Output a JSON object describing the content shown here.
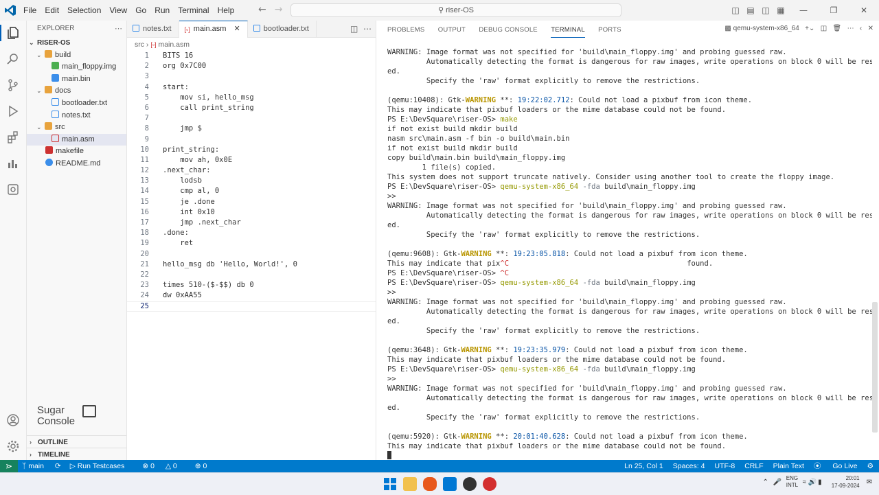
{
  "menu": [
    "File",
    "Edit",
    "Selection",
    "View",
    "Go",
    "Run",
    "Terminal",
    "Help"
  ],
  "search": {
    "text": "riser-OS"
  },
  "explorer": {
    "title": "EXPLORER",
    "root": "RISER-OS",
    "items": [
      {
        "label": "build",
        "type": "folder",
        "depth": 1
      },
      {
        "label": "main_floppy.img",
        "type": "img",
        "depth": 2
      },
      {
        "label": "main.bin",
        "type": "bin",
        "depth": 2
      },
      {
        "label": "docs",
        "type": "folder",
        "depth": 1
      },
      {
        "label": "bootloader.txt",
        "type": "txt",
        "depth": 2
      },
      {
        "label": "notes.txt",
        "type": "txt",
        "depth": 2
      },
      {
        "label": "src",
        "type": "folder",
        "depth": 1
      },
      {
        "label": "main.asm",
        "type": "asm",
        "depth": 2,
        "selected": true
      },
      {
        "label": "makefile",
        "type": "make",
        "depth": 1
      },
      {
        "label": "README.md",
        "type": "info",
        "depth": 1
      }
    ],
    "outline": "OUTLINE",
    "timeline": "TIMELINE"
  },
  "watermark": {
    "line1": "Sugar",
    "line2": "Console"
  },
  "tabs": [
    {
      "label": "notes.txt",
      "active": false
    },
    {
      "label": "main.asm",
      "active": true
    },
    {
      "label": "bootloader.txt",
      "active": false
    }
  ],
  "breadcrumb": {
    "folder": "src",
    "file": "main.asm"
  },
  "code": [
    "BITS 16",
    "org 0x7C00",
    "",
    "start:",
    "    mov si, hello_msg",
    "    call print_string",
    "",
    "    jmp $",
    "",
    "print_string:",
    "    mov ah, 0x0E",
    ".next_char:",
    "    lodsb",
    "    cmp al, 0",
    "    je .done",
    "    int 0x10",
    "    jmp .next_char",
    ".done:",
    "    ret",
    "",
    "hello_msg db 'Hello, World!', 0",
    "",
    "times 510-($-$$) db 0",
    "dw 0xAA55",
    ""
  ],
  "panel_tabs": [
    "PROBLEMS",
    "OUTPUT",
    "DEBUG CONSOLE",
    "TERMINAL",
    "PORTS"
  ],
  "active_panel_tab": "TERMINAL",
  "terminal_name": "qemu-system-x86_64",
  "terminal": [
    [
      {
        "t": "WARNING: Image format was not specified for 'build\\main_floppy.img' and probing guessed raw."
      }
    ],
    [
      {
        "t": "         Automatically detecting the format is dangerous for raw images, write operations on block 0 will be restrict"
      }
    ],
    [
      {
        "t": "ed."
      }
    ],
    [
      {
        "t": "         Specify the 'raw' format explicitly to remove the restrictions."
      }
    ],
    [
      {
        "t": ""
      }
    ],
    [
      {
        "t": "(qemu:10408): Gtk-"
      },
      {
        "t": "WARNING",
        "c": "w"
      },
      {
        "t": " **: "
      },
      {
        "t": "19:22:02.712",
        "c": "ts"
      },
      {
        "t": ": Could not load a pixbuf from icon theme."
      }
    ],
    [
      {
        "t": "This may indicate that pixbuf loaders or the mime database could not be found."
      }
    ],
    [
      {
        "t": "PS E:\\DevSquare\\riser-OS> "
      },
      {
        "t": "make",
        "c": "y"
      }
    ],
    [
      {
        "t": "if not exist build mkdir build"
      }
    ],
    [
      {
        "t": "nasm src\\main.asm -f bin -o build\\main.bin"
      }
    ],
    [
      {
        "t": "if not exist build mkdir build"
      }
    ],
    [
      {
        "t": "copy build\\main.bin build\\main_floppy.img"
      }
    ],
    [
      {
        "t": "        1 file(s) copied."
      }
    ],
    [
      {
        "t": "This system does not support truncate natively. Consider using another tool to create the floppy image."
      }
    ],
    [
      {
        "t": "PS E:\\DevSquare\\riser-OS> "
      },
      {
        "t": "qemu-system-x86_64",
        "c": "y"
      },
      {
        "t": " -fda",
        "c": "d"
      },
      {
        "t": " build\\main_floppy.img"
      }
    ],
    [
      {
        "t": ">>"
      }
    ],
    [
      {
        "t": "WARNING: Image format was not specified for 'build\\main_floppy.img' and probing guessed raw."
      }
    ],
    [
      {
        "t": "         Automatically detecting the format is dangerous for raw images, write operations on block 0 will be restrict"
      }
    ],
    [
      {
        "t": "ed."
      }
    ],
    [
      {
        "t": "         Specify the 'raw' format explicitly to remove the restrictions."
      }
    ],
    [
      {
        "t": ""
      }
    ],
    [
      {
        "t": "(qemu:9608): Gtk-"
      },
      {
        "t": "WARNING",
        "c": "w"
      },
      {
        "t": " **: "
      },
      {
        "t": "19:23:05.818",
        "c": "ts"
      },
      {
        "t": ": Could not load a pixbuf from icon theme."
      }
    ],
    [
      {
        "t": "This may indicate that pix"
      },
      {
        "t": "^C",
        "c": "r"
      },
      {
        "t": "                                         found."
      }
    ],
    [
      {
        "t": "PS E:\\DevSquare\\riser-OS> "
      },
      {
        "t": "^C",
        "c": "r"
      }
    ],
    [
      {
        "t": "PS E:\\DevSquare\\riser-OS> "
      },
      {
        "t": "qemu-system-x86_64",
        "c": "y"
      },
      {
        "t": " -fda",
        "c": "d"
      },
      {
        "t": " build\\main_floppy.img"
      }
    ],
    [
      {
        "t": ">>"
      }
    ],
    [
      {
        "t": "WARNING: Image format was not specified for 'build\\main_floppy.img' and probing guessed raw."
      }
    ],
    [
      {
        "t": "         Automatically detecting the format is dangerous for raw images, write operations on block 0 will be restrict"
      }
    ],
    [
      {
        "t": "ed."
      }
    ],
    [
      {
        "t": "         Specify the 'raw' format explicitly to remove the restrictions."
      }
    ],
    [
      {
        "t": ""
      }
    ],
    [
      {
        "t": "(qemu:3648): Gtk-"
      },
      {
        "t": "WARNING",
        "c": "w"
      },
      {
        "t": " **: "
      },
      {
        "t": "19:23:35.979",
        "c": "ts"
      },
      {
        "t": ": Could not load a pixbuf from icon theme."
      }
    ],
    [
      {
        "t": "This may indicate that pixbuf loaders or the mime database could not be found."
      }
    ],
    [
      {
        "t": "PS E:\\DevSquare\\riser-OS> "
      },
      {
        "t": "qemu-system-x86_64",
        "c": "y"
      },
      {
        "t": " -fda",
        "c": "d"
      },
      {
        "t": " build\\main_floppy.img"
      }
    ],
    [
      {
        "t": ">>"
      }
    ],
    [
      {
        "t": "WARNING: Image format was not specified for 'build\\main_floppy.img' and probing guessed raw."
      }
    ],
    [
      {
        "t": "         Automatically detecting the format is dangerous for raw images, write operations on block 0 will be restrict"
      }
    ],
    [
      {
        "t": "ed."
      }
    ],
    [
      {
        "t": "         Specify the 'raw' format explicitly to remove the restrictions."
      }
    ],
    [
      {
        "t": ""
      }
    ],
    [
      {
        "t": "(qemu:5920): Gtk-"
      },
      {
        "t": "WARNING",
        "c": "w"
      },
      {
        "t": " **: "
      },
      {
        "t": "20:01:40.628",
        "c": "ts"
      },
      {
        "t": ": Could not load a pixbuf from icon theme."
      }
    ],
    [
      {
        "t": "This may indicate that pixbuf loaders or the mime database could not be found."
      }
    ],
    [
      {
        "t": "",
        "cursor": true
      }
    ]
  ],
  "status": {
    "branch": "main",
    "run": "Run Testcases",
    "errors": "0",
    "warnings": "0",
    "ports": "0",
    "position": "Ln 25, Col 1",
    "spaces": "Spaces: 4",
    "encoding": "UTF-8",
    "eol": "CRLF",
    "language": "Plain Text",
    "golive": "Go Live"
  },
  "taskbar": {
    "lang1": "ENG",
    "lang2": "INTL",
    "time": "20:01",
    "date": "17-09-2024"
  },
  "colors": {
    "accent": "#007acc",
    "remote": "#16825d",
    "warning_yellow": "#b89500",
    "prompt_cmd": "#949800",
    "timestamp": "#0451a5"
  }
}
